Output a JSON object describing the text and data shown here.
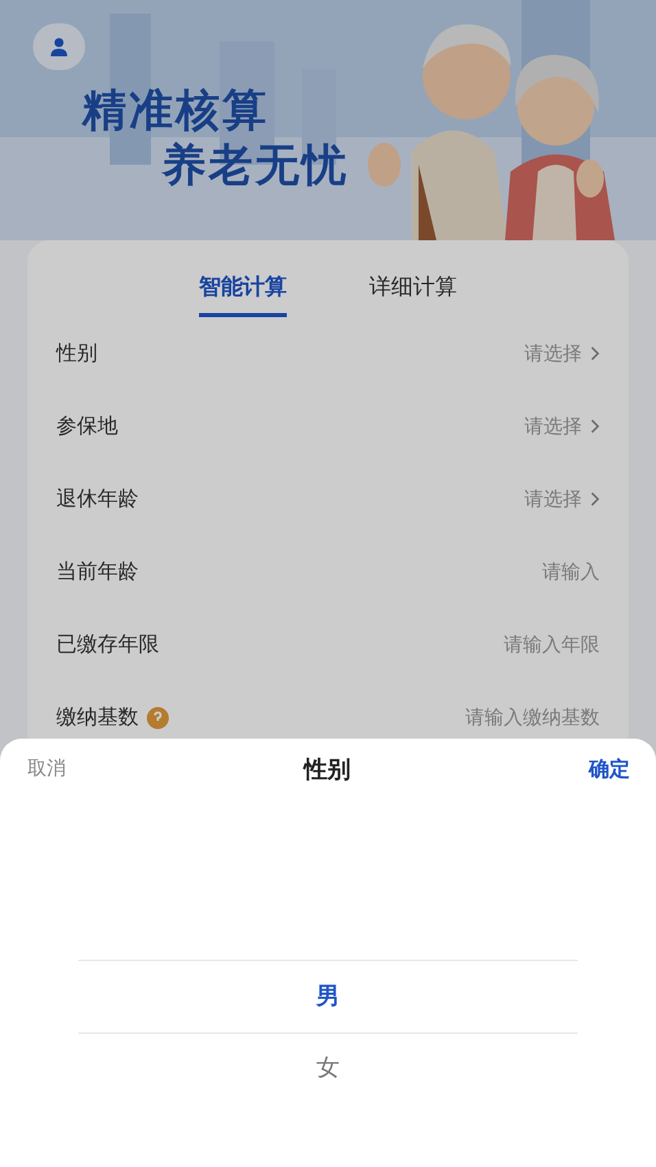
{
  "header": {
    "title_lines": [
      "精准核算",
      "养老无忧"
    ]
  },
  "tabs": [
    {
      "label": "智能计算",
      "selected": true
    },
    {
      "label": "详细计算",
      "selected": false
    }
  ],
  "fields": [
    {
      "label": "性别",
      "placeholder": "请选择",
      "kind": "select"
    },
    {
      "label": "参保地",
      "placeholder": "请选择",
      "kind": "select"
    },
    {
      "label": "退休年龄",
      "placeholder": "请选择",
      "kind": "select"
    },
    {
      "label": "当前年龄",
      "placeholder": "请输入",
      "kind": "input"
    },
    {
      "label": "已缴存年限",
      "placeholder": "请输入年限",
      "kind": "input"
    },
    {
      "label": "缴纳基数",
      "placeholder": "请输入缴纳基数",
      "kind": "input",
      "help": true
    }
  ],
  "sheet": {
    "cancel": "取消",
    "title": "性别",
    "confirm": "确定",
    "options": [
      {
        "label": "男",
        "selected": true
      },
      {
        "label": "女",
        "selected": false
      }
    ]
  }
}
